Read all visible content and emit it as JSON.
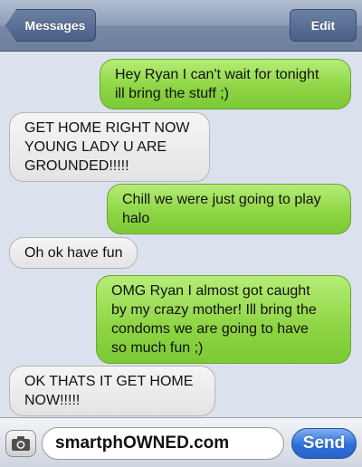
{
  "nav": {
    "back_label": "Messages",
    "edit_label": "Edit"
  },
  "messages": [
    {
      "sender": "me",
      "text": "Hey Ryan I can't wait for tonight\nill bring the stuff ;)"
    },
    {
      "sender": "them",
      "text": "GET HOME RIGHT NOW\nYOUNG LADY U ARE\nGROUNDED!!!!!"
    },
    {
      "sender": "me",
      "text": "Chill we were just going to play\nhalo"
    },
    {
      "sender": "them",
      "text": "Oh ok have fun"
    },
    {
      "sender": "me",
      "text": "OMG Ryan I almost got caught\nby my crazy mother! Ill bring the\ncondoms we are going to have\nso much fun ;)"
    },
    {
      "sender": "them",
      "text": "OK THATS IT GET HOME\nNOW!!!!!"
    }
  ],
  "composer": {
    "text_value": "smartphOWNED.com",
    "send_label": "Send",
    "camera_icon": "camera-icon"
  },
  "colors": {
    "sent_bubble": "#8dd443",
    "received_bubble": "#e3e3e3",
    "background": "#dbe2ed",
    "send_button": "#2f6fd8"
  }
}
